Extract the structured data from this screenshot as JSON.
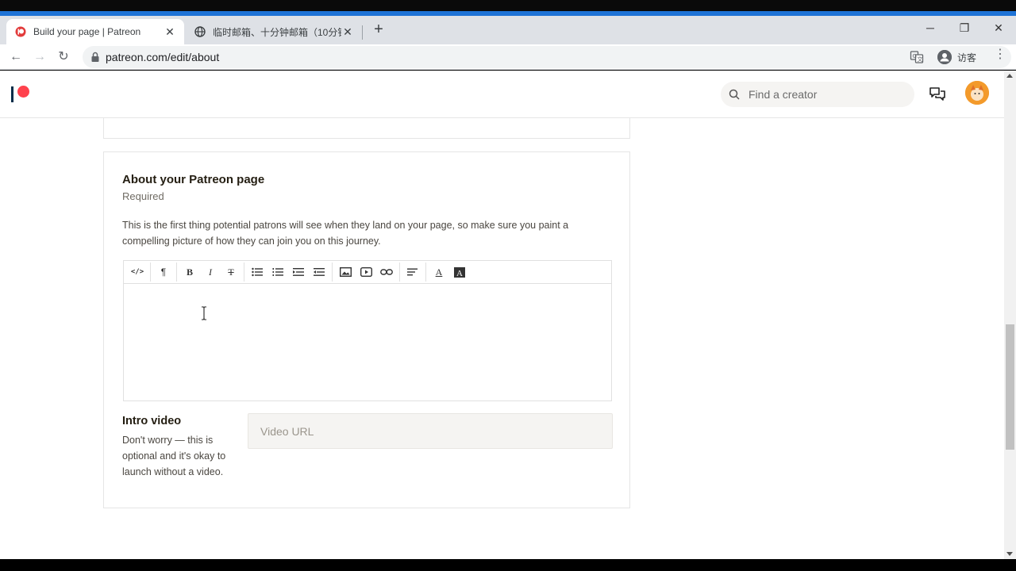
{
  "browser": {
    "tabs": [
      {
        "title": "Build your page | Patreon",
        "close": "✕",
        "icon": "patreon-favicon"
      },
      {
        "title": "临时邮箱、十分钟邮箱（10分钟",
        "close": "✕",
        "icon": "globe-icon"
      }
    ],
    "new_tab": "+",
    "window_controls": {
      "minimize": "─",
      "restore": "❐",
      "close": "✕"
    },
    "nav": {
      "back": "←",
      "forward": "→",
      "reload": "↻"
    },
    "url": "patreon.com/edit/about",
    "profile_label": "访客",
    "menu": "⋮"
  },
  "header": {
    "search_placeholder": "Find a creator"
  },
  "about_section": {
    "title": "About your Patreon page",
    "required": "Required",
    "description": "This is the first thing potential patrons will see when they land on your page, so make sure you paint a compelling picture of how they can join you on this journey.",
    "toolbar": [
      {
        "name": "code-view-icon",
        "glyph": "</>"
      },
      {
        "name": "paragraph-icon",
        "glyph": "¶"
      },
      {
        "name": "bold-icon",
        "glyph": "B"
      },
      {
        "name": "italic-icon",
        "glyph": "I"
      },
      {
        "name": "strikethrough-icon",
        "glyph": "T"
      },
      {
        "name": "bulleted-list-icon",
        "glyph": "☰"
      },
      {
        "name": "numbered-list-icon",
        "glyph": "☰"
      },
      {
        "name": "outdent-icon",
        "glyph": "☰"
      },
      {
        "name": "indent-icon",
        "glyph": "☰"
      },
      {
        "name": "image-icon",
        "glyph": "▣"
      },
      {
        "name": "video-icon",
        "glyph": "▶"
      },
      {
        "name": "link-icon",
        "glyph": "∞"
      },
      {
        "name": "align-icon",
        "glyph": "≡"
      },
      {
        "name": "text-color-icon",
        "glyph": "A"
      },
      {
        "name": "highlight-icon",
        "glyph": "A"
      }
    ]
  },
  "intro_video": {
    "title": "Intro video",
    "description": "Don't worry — this is optional and it's okay to launch without a video.",
    "placeholder": "Video URL"
  },
  "colors": {
    "brand_red": "#ff424d",
    "brand_navy": "#052d49",
    "chrome_accent": "#1e73d6"
  }
}
